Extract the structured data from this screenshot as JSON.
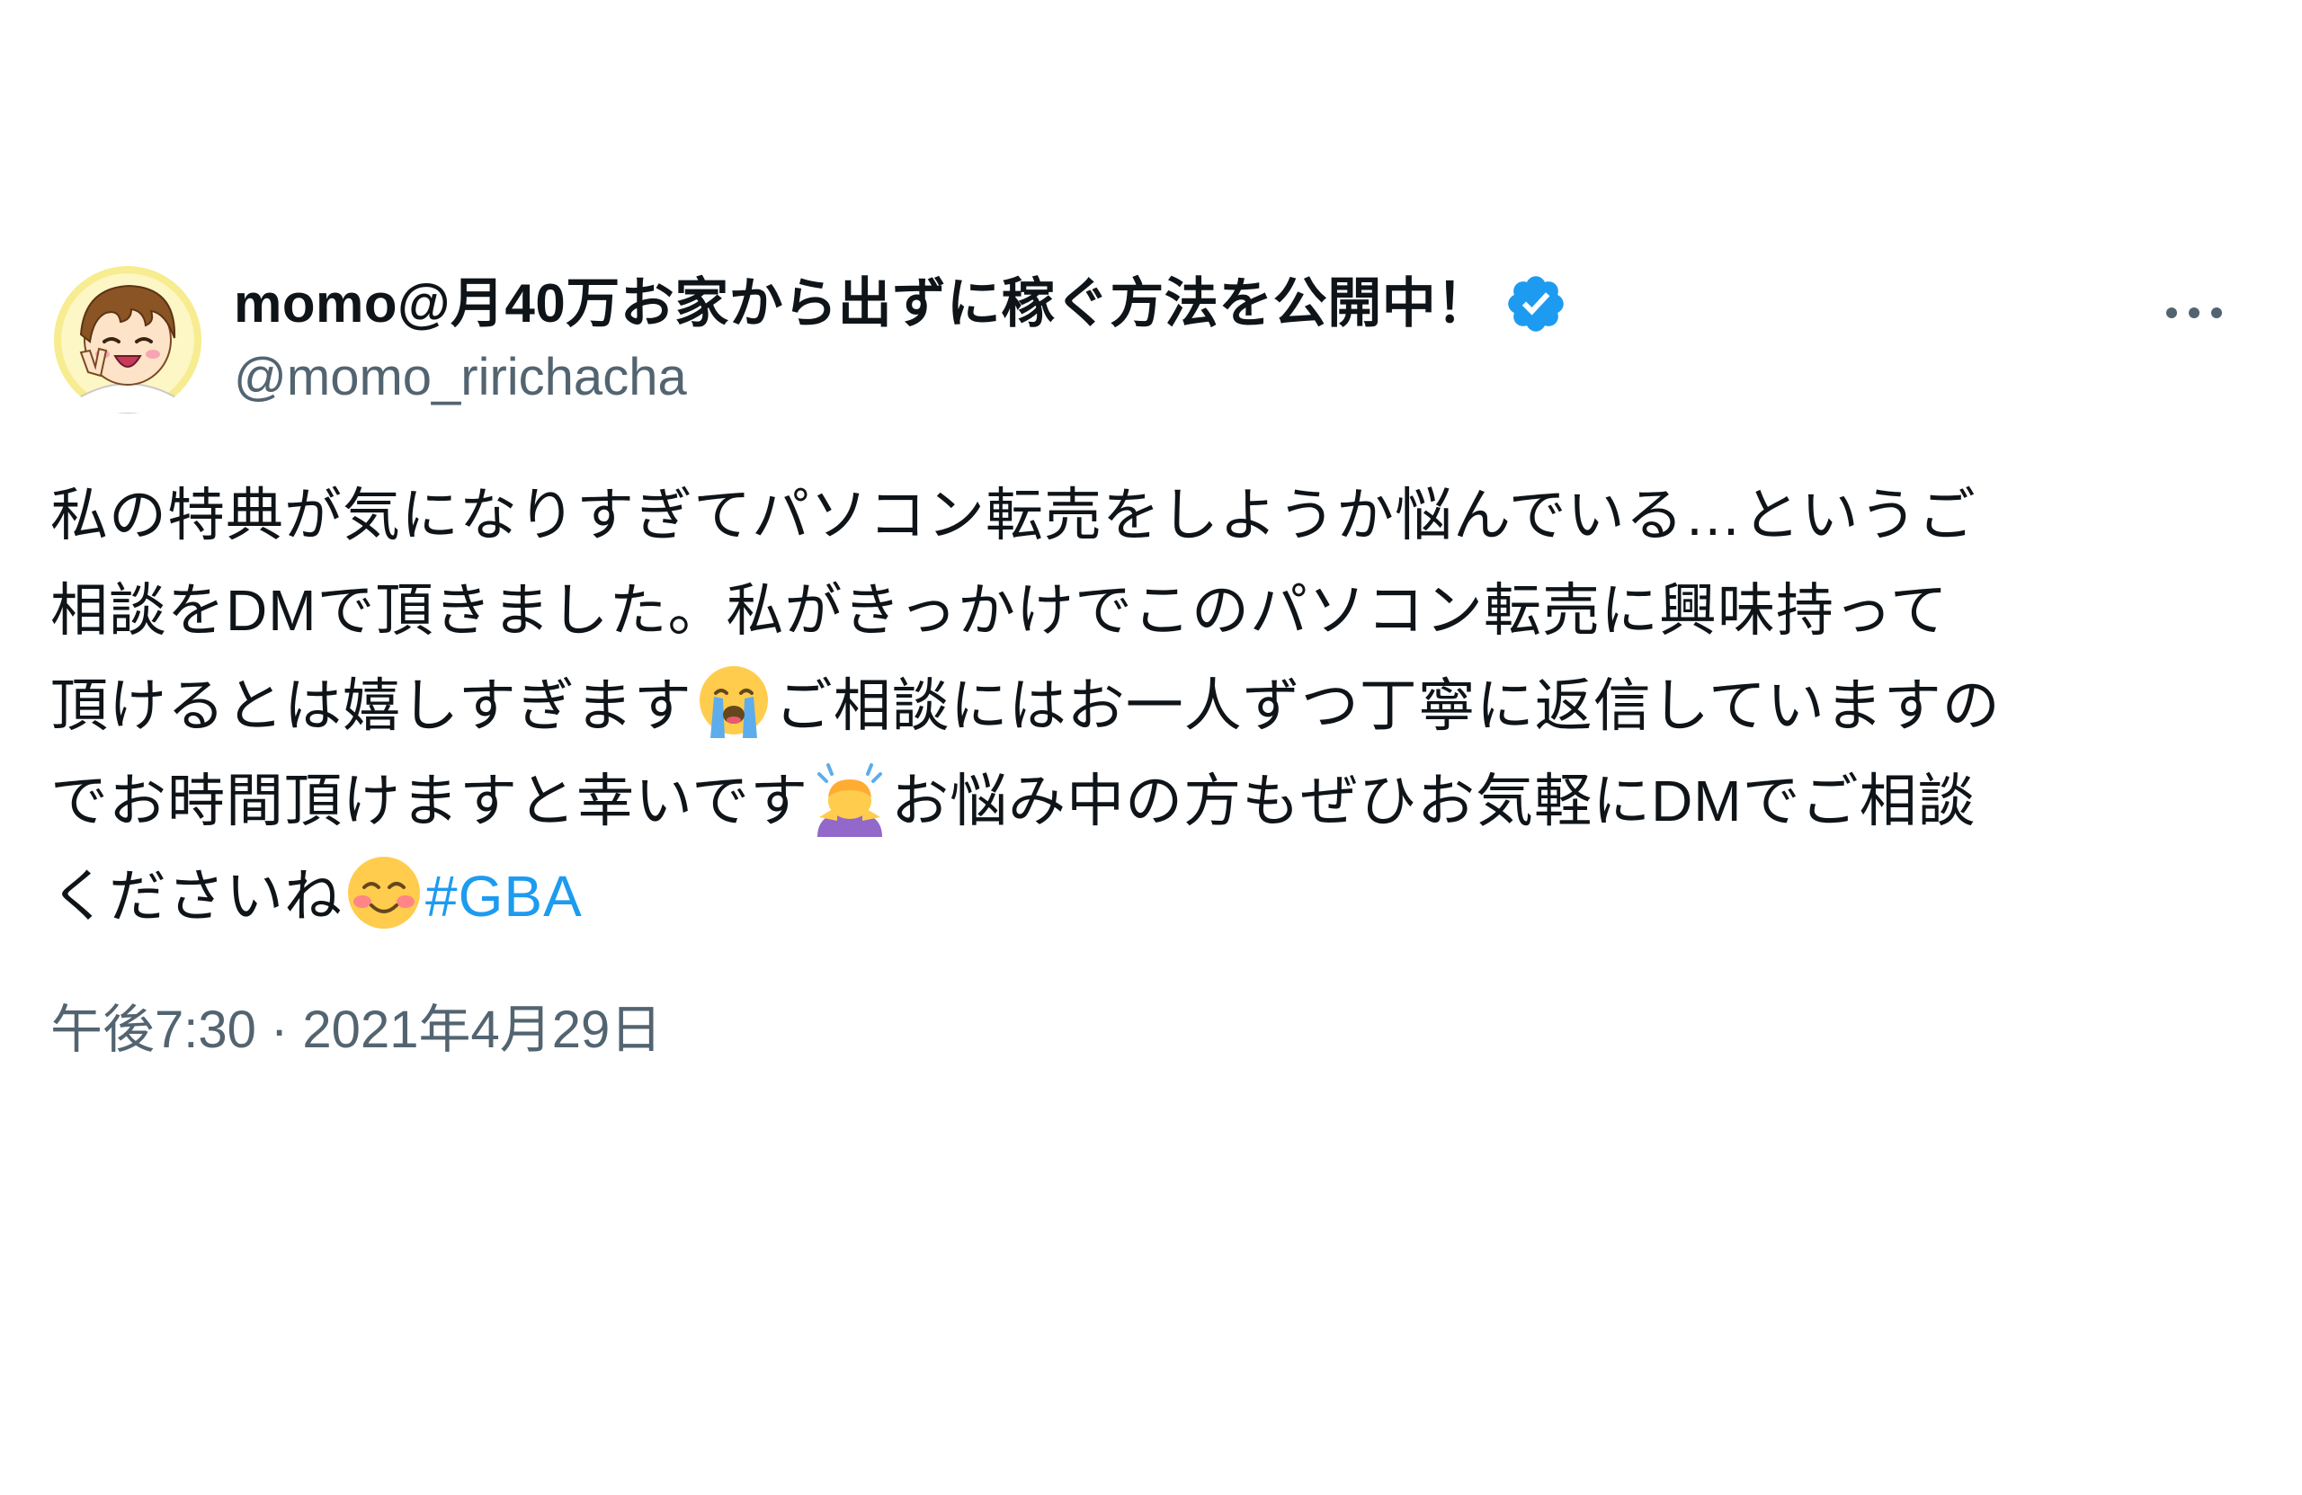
{
  "user": {
    "display_name": "momo@月40万お家から出ずに稼ぐ方法を公開中！",
    "handle": "@momo_ririchacha",
    "verified_icon": "verified-badge-icon",
    "avatar_icon": "cartoon-boy-avatar"
  },
  "tweet": {
    "lines": [
      "私の特典が気になりすぎてパソコン転売をしようか悩んでいる…というご",
      "相談をDMで頂きました。私がきっかけでこのパソコン転売に興味持って",
      "頂けるとは嬉しすぎます",
      "ご相談にはお一人ずつ丁寧に返信していますの",
      "でお時間頂けますと幸いです",
      "お悩み中の方もぜひお気軽にDMでご相談",
      "くださいね"
    ],
    "hashtag": "#GBA",
    "emojis": [
      "loudly-crying-face-emoji",
      "person-bowing-emoji",
      "smiling-face-emoji"
    ]
  },
  "timestamp": "午後7:30 · 2021年4月29日",
  "colors": {
    "text": "#0f1419",
    "secondary": "#536471",
    "link": "#1d9bf0",
    "verified": "#1d9bf0"
  }
}
